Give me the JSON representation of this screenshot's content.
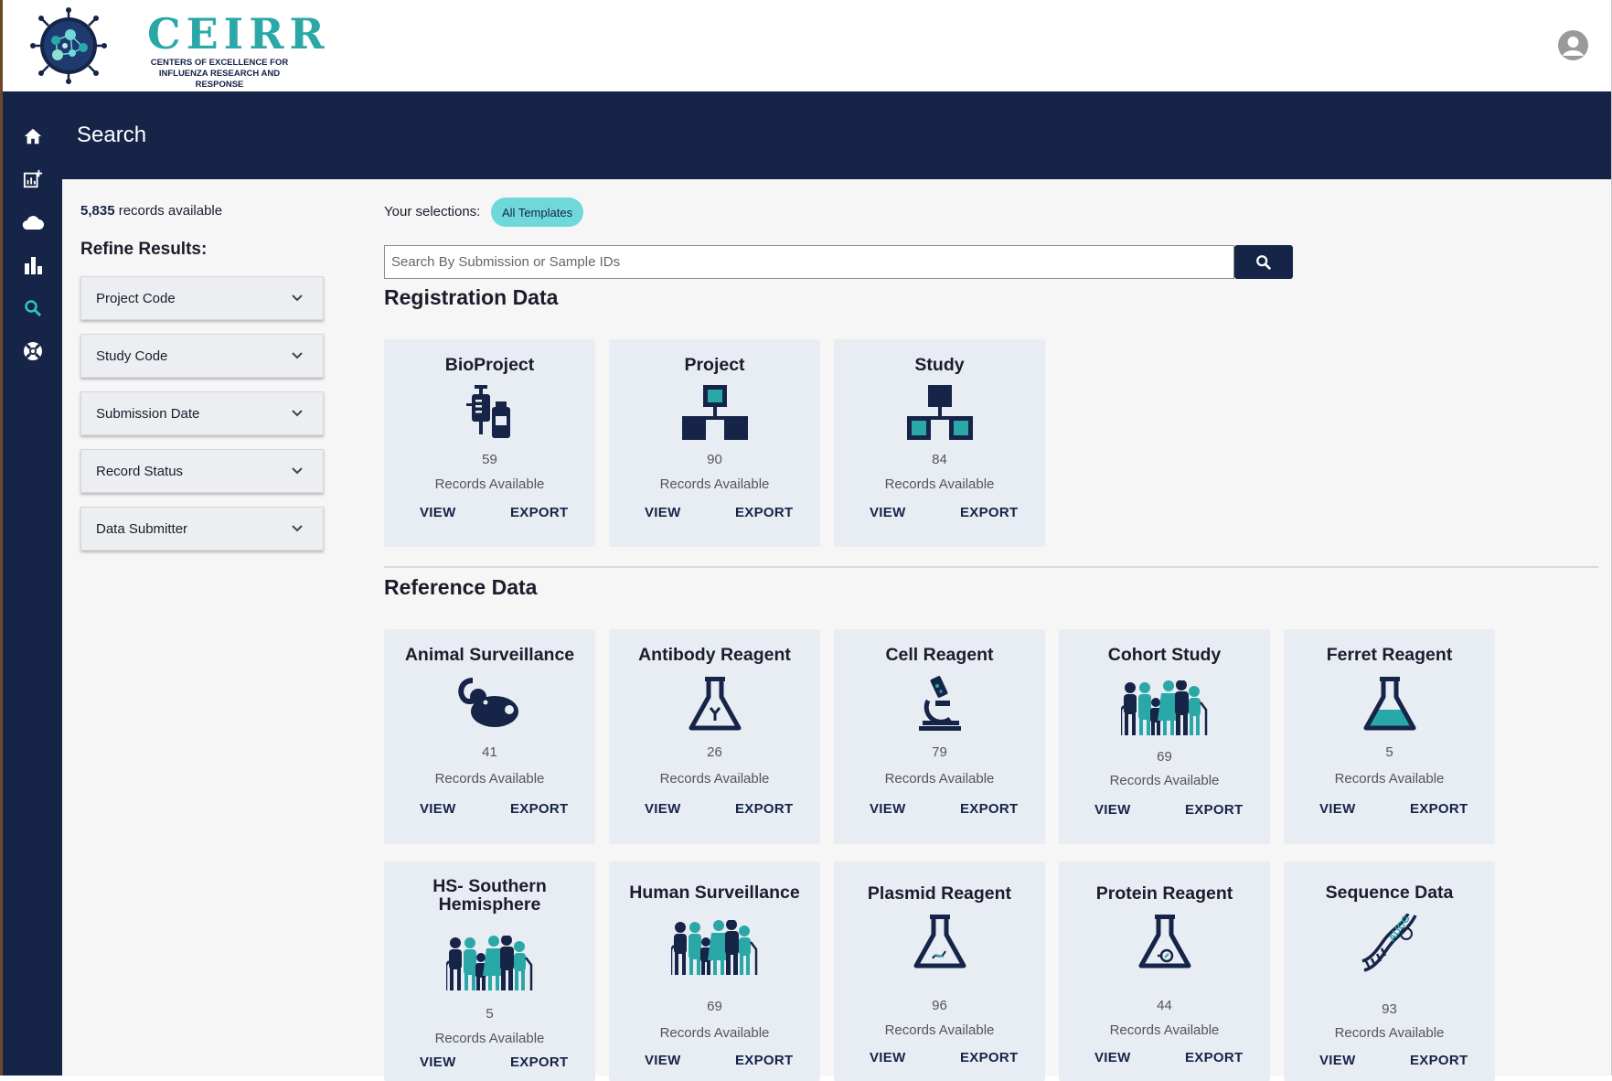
{
  "header": {
    "logo_title": "CEIRR",
    "logo_subtitle_line1": "CENTERS OF EXCELLENCE FOR",
    "logo_subtitle_line2": "INFLUENZA RESEARCH AND RESPONSE"
  },
  "page": {
    "title": "Search"
  },
  "sidebar": {
    "items": [
      "home-icon",
      "report-add-icon",
      "cloud-icon",
      "bar-chart-icon",
      "search-icon",
      "support-icon"
    ]
  },
  "refine": {
    "records_number": "5,835",
    "records_suffix": " records available",
    "title": "Refine Results:",
    "filters": [
      "Project Code",
      "Study Code",
      "Submission Date",
      "Record Status",
      "Data Submitter"
    ]
  },
  "selections": {
    "label": "Your selections:",
    "chip": "All Templates"
  },
  "search": {
    "placeholder": "Search By Submission or Sample IDs"
  },
  "registration": {
    "title": "Registration Data",
    "cards": [
      {
        "title": "BioProject",
        "count": "59",
        "icon": "syringe-vial-icon"
      },
      {
        "title": "Project",
        "count": "90",
        "icon": "hierarchy-icon"
      },
      {
        "title": "Study",
        "count": "84",
        "icon": "hierarchy-icon"
      }
    ]
  },
  "reference": {
    "title": "Reference Data",
    "cards": [
      {
        "title": "Animal Surveillance",
        "count": "41",
        "icon": "mouse-icon"
      },
      {
        "title": "Antibody Reagent",
        "count": "26",
        "icon": "flask-antibody-icon"
      },
      {
        "title": "Cell Reagent",
        "count": "79",
        "icon": "microscope-icon"
      },
      {
        "title": "Cohort Study",
        "count": "69",
        "icon": "family-icon"
      },
      {
        "title": "Ferret Reagent",
        "count": "5",
        "icon": "flask-filled-icon"
      },
      {
        "title_line1": "HS- Southern",
        "title_line2": "Hemisphere",
        "count": "5",
        "icon": "family-icon"
      },
      {
        "title": "Human Surveillance",
        "count": "69",
        "icon": "family-icon"
      },
      {
        "title": "Plasmid Reagent",
        "count": "96",
        "icon": "flask-plasmid-icon"
      },
      {
        "title": "Protein Reagent",
        "count": "44",
        "icon": "flask-protein-icon"
      },
      {
        "title": "Sequence Data",
        "count": "93",
        "icon": "dna-icon"
      }
    ]
  },
  "card_labels": {
    "records_available": "Records Available",
    "view": "VIEW",
    "export": "EXPORT"
  },
  "colors": {
    "navy": "#162448",
    "teal": "#2aa8a8",
    "chip": "#6fd9d9",
    "card": "#e8ecf3"
  }
}
